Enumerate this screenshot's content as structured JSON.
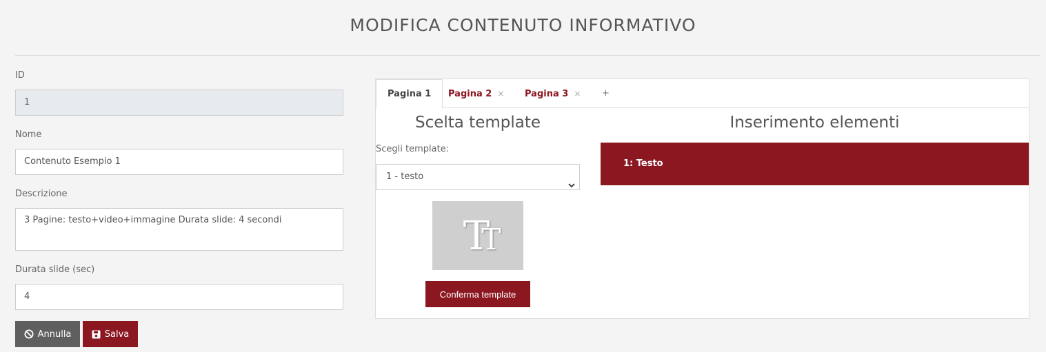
{
  "page": {
    "title": "MODIFICA CONTENUTO INFORMATIVO"
  },
  "form": {
    "id_label": "ID",
    "id_value": "1",
    "nome_label": "Nome",
    "nome_value": "Contenuto Esempio 1",
    "descrizione_label": "Descrizione",
    "descrizione_value": "3 Pagine: testo+video+immagine Durata slide: 4 secondi",
    "durata_label": "Durata slide (sec)",
    "durata_value": "4",
    "annulla_label": "Annulla",
    "salva_label": "Salva"
  },
  "tabs": [
    {
      "label": "Pagina 1",
      "active": true
    },
    {
      "label": "Pagina 2",
      "closable": true
    },
    {
      "label": "Pagina 3",
      "closable": true
    },
    {
      "label": "+"
    }
  ],
  "tab_close_glyph": "×",
  "template_section": {
    "title": "Scelta template",
    "select_label": "Scegli template:",
    "select_value": "1 - testo",
    "preview_glyph_big": "T",
    "preview_glyph_small": "T",
    "confirm_label": "Conferma template"
  },
  "elements_section": {
    "title": "Inserimento elementi",
    "items": [
      {
        "label": "1: Testo"
      }
    ]
  },
  "colors": {
    "accent": "#8b1720",
    "secondary_button": "#5f5f5f",
    "background": "#f4f4f4"
  },
  "icons": {
    "annulla": "ban-icon",
    "salva": "floppy-disk-icon",
    "select": "chevron-down-icon"
  }
}
